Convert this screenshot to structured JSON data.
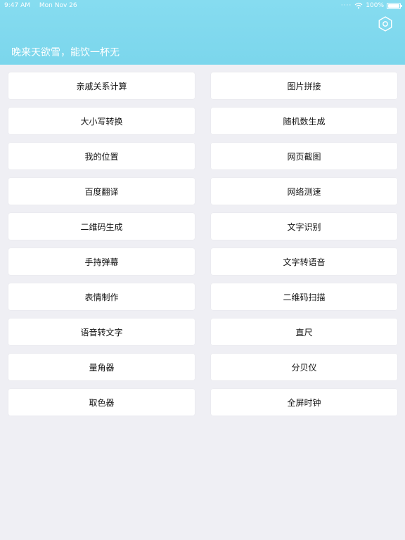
{
  "status_bar": {
    "time": "9:47 AM",
    "date": "Mon Nov 26",
    "battery": "100%",
    "signal_icon": "signal-dots-icon",
    "wifi_icon": "wifi-icon",
    "battery_icon": "battery-icon"
  },
  "header": {
    "title": "晚来天欲雪，能饮一杯无",
    "settings_icon": "hexagon-settings-icon",
    "background_color": "#7bd6ec"
  },
  "tools": [
    "亲戚关系计算",
    "图片拼接",
    "大小写转换",
    "随机数生成",
    "我的位置",
    "网页截图",
    "百度翻译",
    "网络测速",
    "二维码生成",
    "文字识别",
    "手持弹幕",
    "文字转语音",
    "表情制作",
    "二维码扫描",
    "语音转文字",
    "直尺",
    "量角器",
    "分贝仪",
    "取色器",
    "全屏时钟"
  ]
}
